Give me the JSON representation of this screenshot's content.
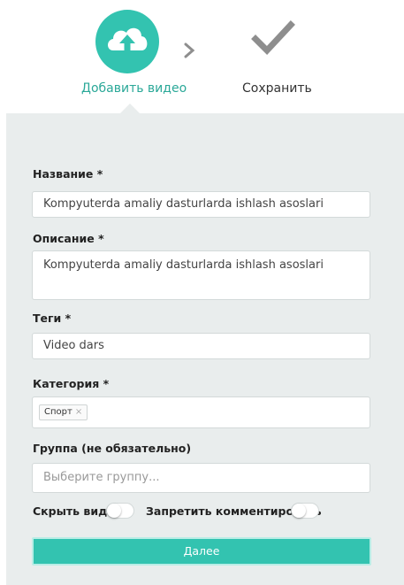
{
  "stepper": {
    "steps": [
      {
        "label": "Добавить видео",
        "icon": "cloud-upload-icon",
        "state": "active"
      },
      {
        "label": "Сохранить",
        "icon": "checkmark-icon",
        "state": "inactive"
      }
    ],
    "separator_icon": "chevron-right-icon"
  },
  "form": {
    "title": {
      "label": "Название *",
      "value": "Kompyuterda amaliy dasturlarda ishlash asoslari"
    },
    "description": {
      "label": "Описание *",
      "value": "Kompyuterda amaliy dasturlarda ishlash asoslari"
    },
    "tags": {
      "label": "Теги *",
      "value": "Video dars"
    },
    "category": {
      "label": "Категория *",
      "selected": [
        {
          "label": "Спорт",
          "remove_icon": "×"
        }
      ]
    },
    "group": {
      "label": "Группа (не обязательно)",
      "placeholder": "Выберите группу..."
    },
    "hide_video": {
      "label": "Скрыть видео",
      "on": false
    },
    "disable_comments": {
      "label": "Запретить комментировать",
      "on": false
    },
    "next_button": "Далее"
  },
  "colors": {
    "accent": "#33c3b0",
    "panel_bg": "#e9eded",
    "check_gray": "#8e8e8e"
  }
}
